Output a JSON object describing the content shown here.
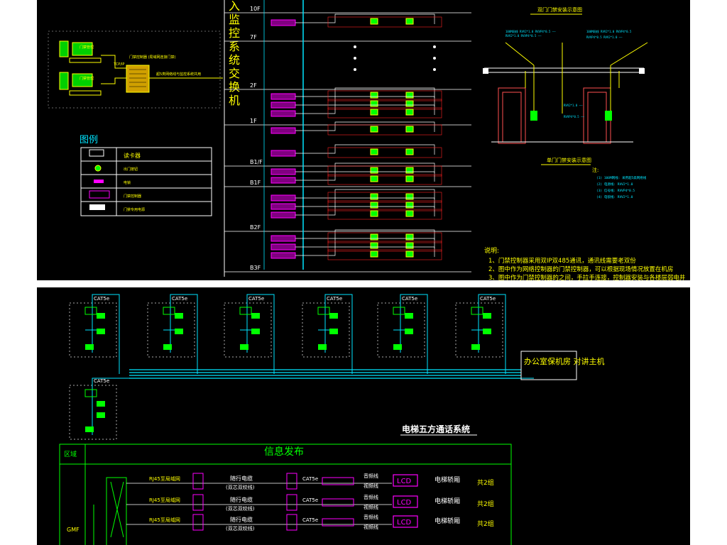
{
  "top": {
    "vertical_title": [
      "入",
      "监",
      "控",
      "系",
      "统",
      "交",
      "换",
      "机"
    ],
    "floors": [
      "10F",
      "7F",
      "2F",
      "1F",
      "B1/F",
      "B1F",
      "B2F",
      "B3F"
    ],
    "legend": {
      "title": "图例",
      "items": [
        {
          "label": "读卡器"
        },
        {
          "label": "出门按钮"
        },
        {
          "label": "电锁"
        },
        {
          "label": "门禁控制器"
        },
        {
          "label": "门禁专用电源"
        }
      ]
    },
    "workstation": {
      "monitor_label_1": "门禁管理",
      "monitor_label_2": "门禁管理",
      "server_label": "门禁控制器\n(局域网连接门禁)",
      "link_text": "TCP/IP",
      "bus_text": "超5类网络线与监控系统共用"
    },
    "door_titles": {
      "double": "双门门禁安装示意图",
      "single": "单门门禁安装示意图"
    },
    "notes_title": "注:",
    "notes": [
      "(1) 100M网线: 采用超5类网络线",
      "(2) 电源线: RVV2*1.0",
      "(3) 信号线: RVVP4*0.5",
      "(4) 电锁线: RVV2*1.0"
    ],
    "explain_title": "说明:",
    "explain": [
      "1、门禁控制器采用双IP双485通讯，通讯线需要老双份",
      "2、图中作为网络控制器的门禁控制器，可以根据现场情况放置在机房",
      "3、图中作为门禁控制器的之间，手拉手连接，控制器安装与各楼层弱电井"
    ]
  },
  "bottom": {
    "units": [
      {
        "cable": "CAT5e"
      },
      {
        "cable": "CAT5e"
      },
      {
        "cable": "CAT5e"
      },
      {
        "cable": "CAT5e"
      },
      {
        "cable": "CAT5e"
      },
      {
        "cable": "CAT5e"
      },
      {
        "cable": "CAT5e"
      }
    ],
    "host_label": "办公室保机房\n对讲主机",
    "elevator_title": "电梯五方通话系统",
    "info_region": "区域",
    "info_title": "信息发布",
    "floor_label": "GMF",
    "rows": [
      {
        "rj": "RJ45至局域网",
        "cable": "随行电缆",
        "cable2": "(双芯双绞线)",
        "cat": "CAT5e",
        "audio": "音频线",
        "video": "视频线",
        "lcd": "LCD",
        "car": "电梯轿厢",
        "count": "共2组"
      },
      {
        "rj": "RJ45至局域网",
        "cable": "随行电缆",
        "cable2": "(双芯双绞线)",
        "cat": "CAT5e",
        "audio": "音频线",
        "video": "视频线",
        "lcd": "LCD",
        "car": "电梯轿厢",
        "count": "共2组"
      },
      {
        "rj": "RJ45至局域网",
        "cable": "随行电缆",
        "cable2": "(双芯双绞线)",
        "cat": "CAT5e",
        "audio": "音频线",
        "video": "视频线",
        "lcd": "LCD",
        "car": "电梯轿厢",
        "count": "共2组"
      }
    ]
  },
  "colors": {
    "cyan": "#00e5ff",
    "magenta": "#ff00ff",
    "yellow": "#ffff00",
    "green": "#00ff00",
    "white": "#ffffff",
    "red": "#ff2020"
  }
}
